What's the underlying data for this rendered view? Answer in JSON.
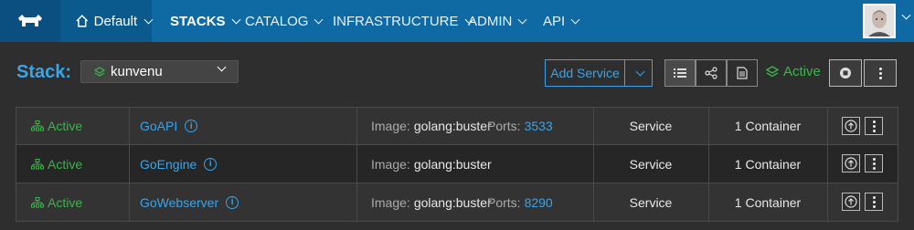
{
  "nav": {
    "environment": "Default",
    "items": [
      {
        "label": "STACKS",
        "active": true
      },
      {
        "label": "CATALOG"
      },
      {
        "label": "INFRASTRUCTURE"
      },
      {
        "label": "ADMIN"
      },
      {
        "label": "API"
      }
    ]
  },
  "stack": {
    "label": "Stack:",
    "selected": "kunvenu",
    "add_service": "Add Service",
    "state": "Active"
  },
  "services": [
    {
      "state": "Active",
      "name": "GoAPI",
      "image_label": "Image:",
      "image": "golang:buster",
      "ports_label": "Ports:",
      "ports": "3533",
      "kind": "Service",
      "containers": "1 Container"
    },
    {
      "state": "Active",
      "name": "GoEngine",
      "image_label": "Image:",
      "image": "golang:buster",
      "ports_label": "",
      "ports": "",
      "kind": "Service",
      "containers": "1 Container"
    },
    {
      "state": "Active",
      "name": "GoWebserver",
      "image_label": "Image:",
      "image": "golang:buster",
      "ports_label": "Ports:",
      "ports": "8290",
      "kind": "Service",
      "containers": "1 Container"
    }
  ],
  "colors": {
    "accent": "#3ba3e8",
    "active": "#3bb54a",
    "nav": "#0f6aa3"
  }
}
